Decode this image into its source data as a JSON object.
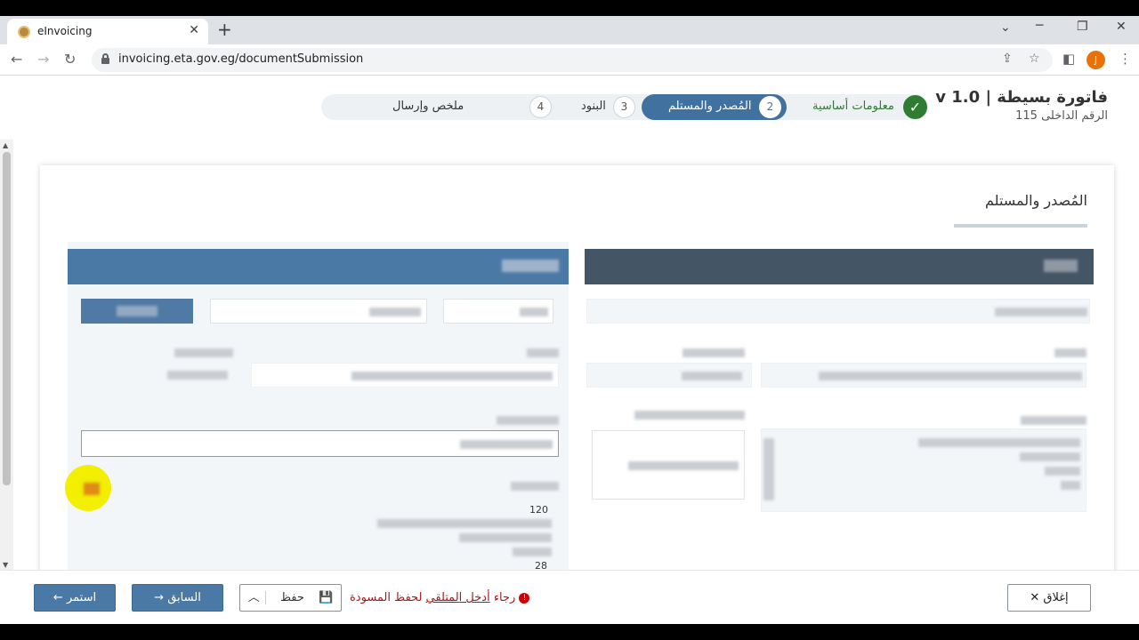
{
  "browser": {
    "tab_title": "eInvoicing",
    "url": "invoicing.eta.gov.eg/documentSubmission",
    "profile_initial": "J"
  },
  "header": {
    "title": "فاتورة بسيطة | v 1.0",
    "internal_ref": "الرقم الداخلى 115"
  },
  "stepper": {
    "steps": [
      {
        "num": "1",
        "label": "معلومات أساسية",
        "state": "done"
      },
      {
        "num": "2",
        "label": "المُصدر والمستلم",
        "state": "active"
      },
      {
        "num": "3",
        "label": "البنود",
        "state": "pending"
      },
      {
        "num": "4",
        "label": "ملخص وإرسال",
        "state": "pending"
      }
    ]
  },
  "section": {
    "title": "المُصدر والمستلم",
    "visible_numbers": [
      "120",
      "28"
    ]
  },
  "footer": {
    "continue_label": "استمر",
    "previous_label": "السابق",
    "save_label": "حفظ",
    "warning_prefix": "رجاء",
    "warning_link": "أدخل المتلقي",
    "warning_suffix": "لحفظ المسودة",
    "close_label": "إغلاق"
  },
  "colors": {
    "primary": "#4b79a6",
    "issuer_header": "#445566",
    "success": "#2e7d32",
    "warning": "#a31b1b"
  }
}
